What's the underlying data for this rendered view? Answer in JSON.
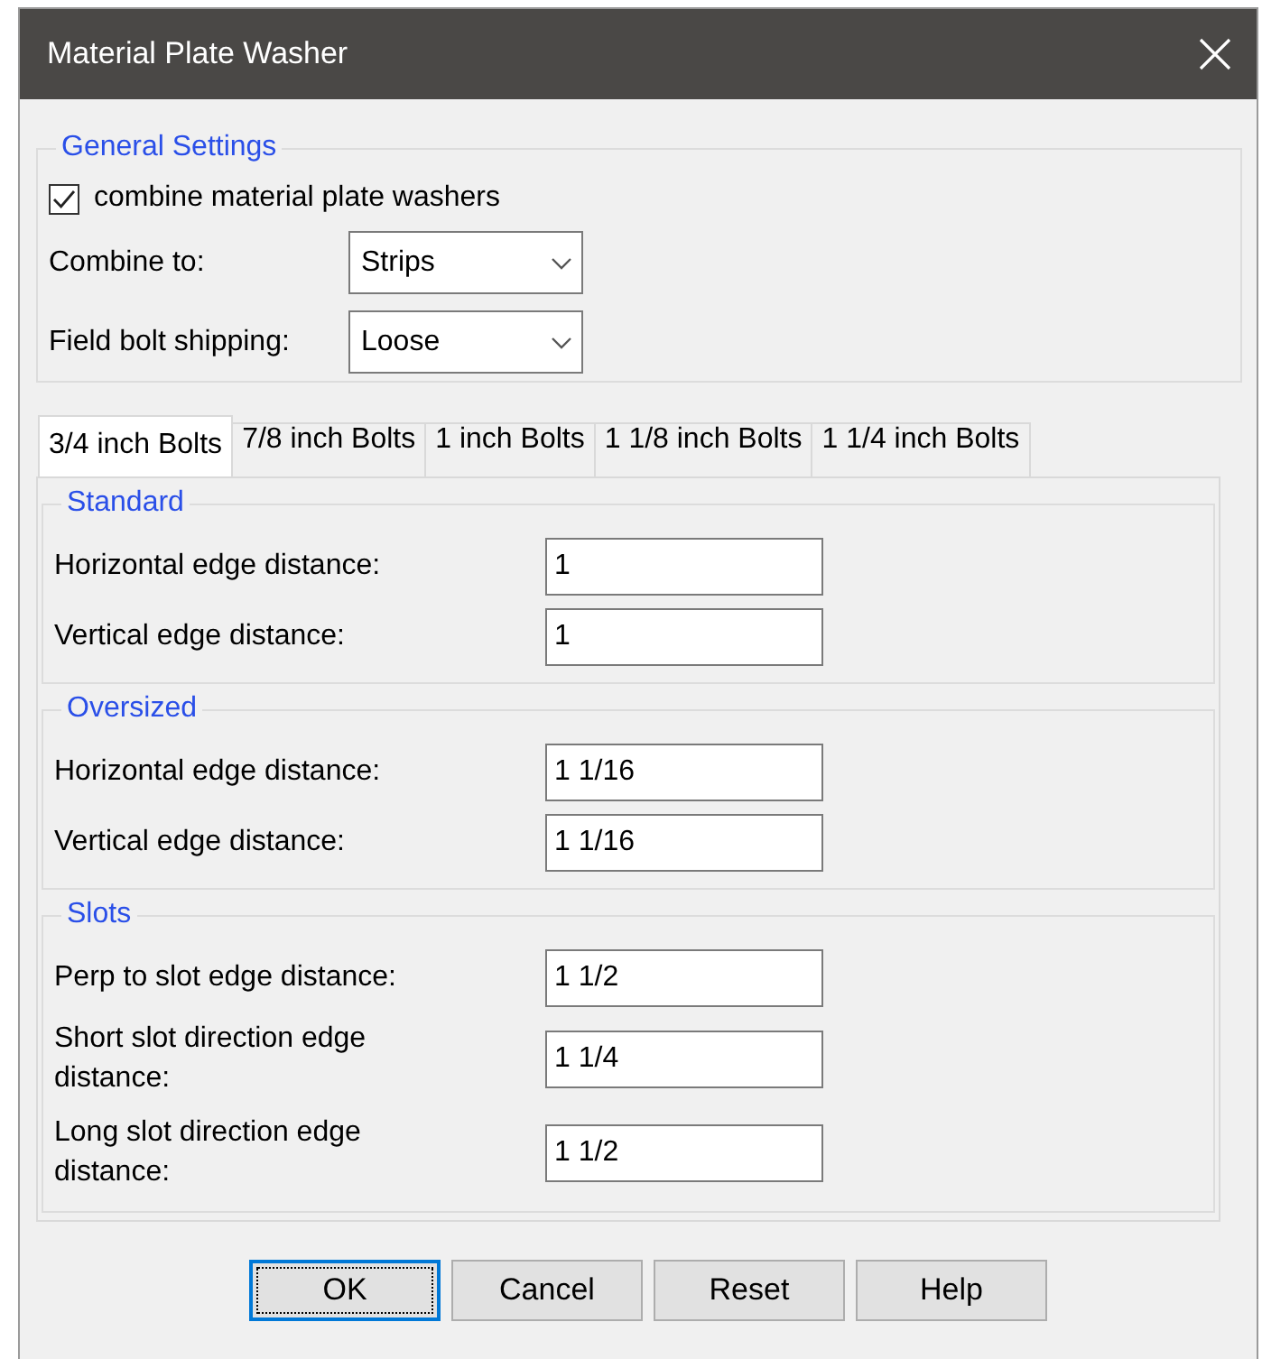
{
  "window": {
    "title": "Material Plate Washer"
  },
  "general_settings": {
    "title": "General Settings",
    "checkbox": {
      "label": "combine material plate washers",
      "checked": true
    },
    "dropdowns": [
      {
        "label": "Combine to:",
        "value": "Strips"
      },
      {
        "label": "Field bolt shipping:",
        "value": "Loose"
      }
    ]
  },
  "tabs": [
    {
      "label": "3/4 inch Bolts",
      "selected": true
    },
    {
      "label": "7/8 inch Bolts",
      "selected": false
    },
    {
      "label": "1 inch Bolts",
      "selected": false
    },
    {
      "label": "1 1/8 inch Bolts",
      "selected": false
    },
    {
      "label": "1 1/4 inch Bolts",
      "selected": false
    }
  ],
  "sections": [
    {
      "title": "Standard",
      "fields": [
        {
          "label": "Horizontal edge distance:",
          "value": "1"
        },
        {
          "label": "Vertical edge distance:",
          "value": "1"
        }
      ]
    },
    {
      "title": "Oversized",
      "fields": [
        {
          "label": "Horizontal edge distance:",
          "value": "1 1/16"
        },
        {
          "label": "Vertical edge distance:",
          "value": "1 1/16"
        }
      ]
    },
    {
      "title": "Slots",
      "fields": [
        {
          "label": "Perp to slot edge distance:",
          "value": "1 1/2"
        },
        {
          "label": "Short slot direction edge distance:",
          "value": "1 1/4"
        },
        {
          "label": "Long slot direction edge distance:",
          "value": "1 1/2"
        }
      ]
    }
  ],
  "buttons": [
    {
      "label": "OK",
      "default": true
    },
    {
      "label": "Cancel",
      "default": false
    },
    {
      "label": "Reset",
      "default": false
    },
    {
      "label": "Help",
      "default": false
    }
  ]
}
